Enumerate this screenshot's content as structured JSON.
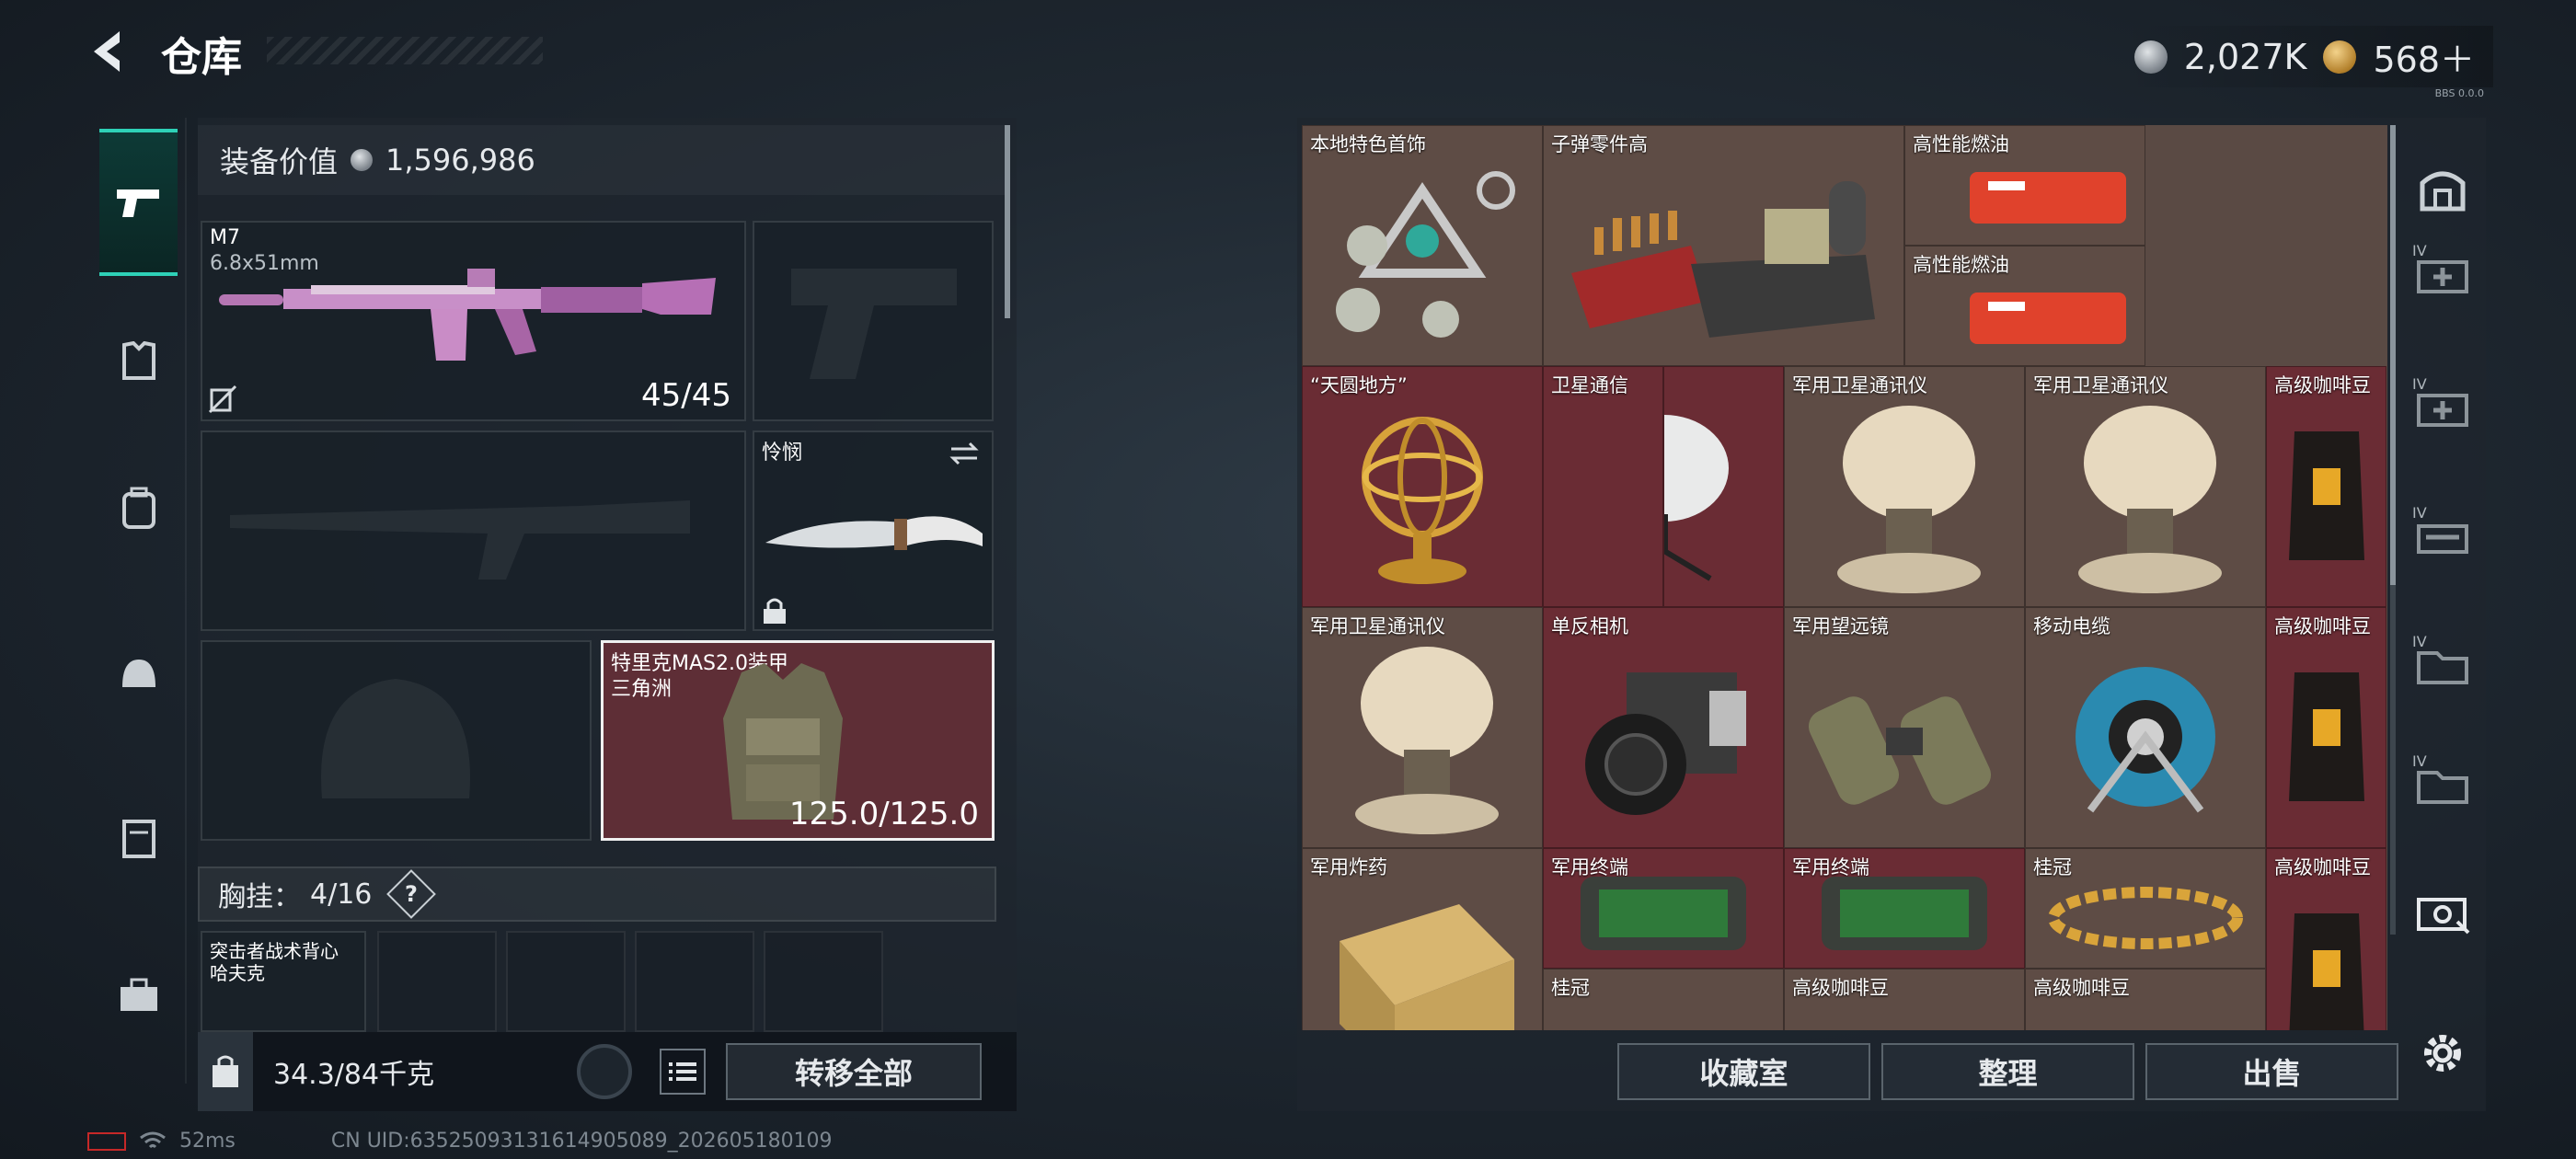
{
  "header": {
    "title": "仓库",
    "silver": "2,027K",
    "gold": "568＋",
    "version": "BBS 0.0.0"
  },
  "left_nav": [
    "pistol-icon",
    "armor-icon",
    "backpack-icon",
    "helmet-icon",
    "case-icon",
    "toolbox-icon"
  ],
  "equipment": {
    "value_label": "装备价值",
    "value": "1,596,986"
  },
  "slots": {
    "primary": {
      "name": "M7",
      "caliber": "6.8x51mm",
      "ammo": "45/45"
    },
    "melee": {
      "name": "怜悯"
    },
    "armor": {
      "name": "特里克MAS2.0装甲",
      "sub": "三角洲",
      "durability": "125.0/125.0"
    }
  },
  "rig": {
    "label": "胸挂：",
    "count": "4/16",
    "help": "?"
  },
  "rig_item": {
    "line1": "突击者战术背心",
    "line2": "哈夫克"
  },
  "weight": {
    "current": "34.3",
    "max": "/84千克"
  },
  "actions": {
    "transfer_all": "转移全部",
    "collection": "收藏室",
    "sort": "整理",
    "sell": "出售"
  },
  "status": {
    "ping": "52ms",
    "uid": "CN UID:63525093131614905089_202605180109"
  },
  "items": [
    {
      "name": "本地特色首饰",
      "bg": "brn"
    },
    {
      "name": "子弹零件高",
      "bg": "brn"
    },
    {
      "name": "高性能燃油",
      "bg": "brn"
    },
    {
      "name": "高性能燃油",
      "bg": "brn"
    },
    {
      "name": "“天圆地方”",
      "bg": "red"
    },
    {
      "name": "卫星通信",
      "bg": "red"
    },
    {
      "name": "军用卫星通讯仪",
      "bg": "brn"
    },
    {
      "name": "军用卫星通讯仪",
      "bg": "brn"
    },
    {
      "name": "高级咖啡豆",
      "bg": "red"
    },
    {
      "name": "军用卫星通讯仪",
      "bg": "brn"
    },
    {
      "name": "单反相机",
      "bg": "red"
    },
    {
      "name": "军用望远镜",
      "bg": "brn"
    },
    {
      "name": "移动电缆",
      "bg": "brn"
    },
    {
      "name": "高级咖啡豆",
      "bg": "red"
    },
    {
      "name": "军用炸药",
      "bg": "brn"
    },
    {
      "name": "军用终端",
      "bg": "red"
    },
    {
      "name": "军用终端",
      "bg": "red"
    },
    {
      "name": "桂冠",
      "bg": "brn"
    },
    {
      "name": "高级咖啡豆",
      "bg": "red"
    },
    {
      "name": "桂冠",
      "bg": "brn"
    },
    {
      "name": "高级咖啡豆",
      "bg": "brn"
    },
    {
      "name": "高级咖啡豆",
      "bg": "brn"
    }
  ],
  "right_nav": [
    "stash-icon",
    "medkit-icon",
    "medkit-icon-2",
    "weapon-case-icon",
    "folder-icon",
    "folder-icon-2",
    "camera-case-icon",
    "settings-icon"
  ],
  "right_nav_tags": {
    "tier": "IV"
  }
}
